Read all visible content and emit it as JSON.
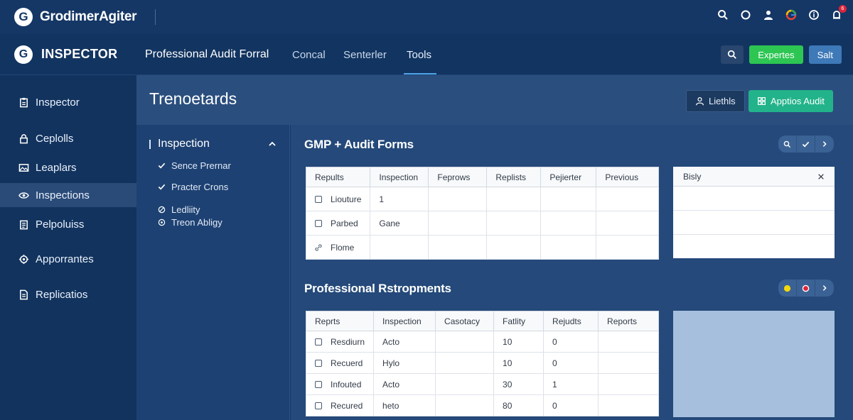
{
  "topbar": {
    "logo_letter": "G",
    "brand": "GrodimerAgiter",
    "notification_count": "6"
  },
  "navbar": {
    "logo_letter": "G",
    "brand": "INSPECTOR",
    "title": "Professional Audit Forral",
    "tabs": [
      {
        "label": "Concal"
      },
      {
        "label": "Senterler"
      },
      {
        "label": "Tools"
      }
    ],
    "export_label": "Expertes",
    "save_label": "Salt"
  },
  "sidebar": {
    "items": [
      {
        "label": "Inspector",
        "icon": "clipboard-icon"
      },
      {
        "label": "Ceplolls",
        "icon": "lock-icon"
      },
      {
        "label": "Leaplars",
        "icon": "image-icon"
      },
      {
        "label": "Inspections",
        "icon": "eye-icon"
      },
      {
        "label": "Pelpoluiss",
        "icon": "clipboard-list-icon"
      },
      {
        "label": "Apporrantes",
        "icon": "gear-icon"
      },
      {
        "label": "Replicatios",
        "icon": "document-icon"
      }
    ]
  },
  "header": {
    "title": "Trenoetards",
    "btn_dark": "Liethls",
    "btn_teal": "Apptios Audit"
  },
  "left_panel": {
    "heading": "Inspection",
    "items": [
      {
        "label": "Sence Prernar",
        "icon": "check-icon"
      },
      {
        "label": "Practer Crons",
        "icon": "check-icon"
      },
      {
        "label": "Ledliity",
        "icon": "circle-slash-icon"
      },
      {
        "label": "Treon Abligy",
        "icon": "target-icon"
      }
    ]
  },
  "section1": {
    "title": "GMP + Audit Forms",
    "columns": [
      "Repults",
      "Inspection",
      "Feprows",
      "Replists",
      "Pejierter",
      "Previous"
    ],
    "rows": [
      {
        "label": "Liouture",
        "cells": [
          "1",
          "",
          "",
          "",
          ""
        ]
      },
      {
        "label": "Parbed",
        "cells": [
          "Gane",
          "",
          "",
          "",
          ""
        ]
      },
      {
        "label": "Flome",
        "cells": [
          "",
          "",
          "",
          "",
          ""
        ]
      }
    ],
    "side_card_title": "Bisly"
  },
  "section2": {
    "title": "Professional Rstropments",
    "columns": [
      "Reprts",
      "Inspection",
      "Casotacy",
      "Fatlity",
      "Rejudts",
      "Reports"
    ],
    "rows": [
      {
        "label": "Resdiurn",
        "cells": [
          "Acto",
          "",
          "10",
          "0",
          ""
        ]
      },
      {
        "label": "Recuerd",
        "cells": [
          "Hylo",
          "",
          "10",
          "0",
          ""
        ]
      },
      {
        "label": "Infouted",
        "cells": [
          "Acto",
          "",
          "30",
          "1",
          ""
        ]
      },
      {
        "label": "Recured",
        "cells": [
          "heto",
          "",
          "80",
          "0",
          ""
        ]
      }
    ]
  },
  "colors": {
    "accent_green": "#2dc653",
    "accent_teal": "#22b38a",
    "status_yellow": "#f5d90a",
    "status_red": "#e0243b"
  }
}
